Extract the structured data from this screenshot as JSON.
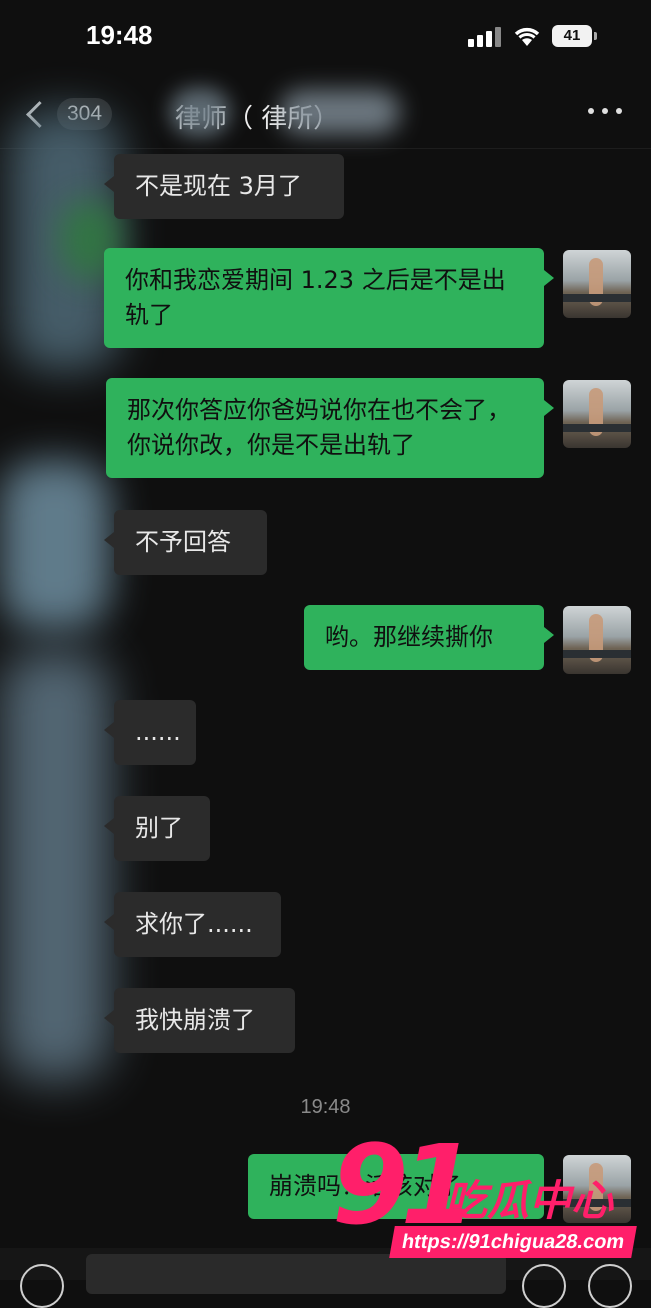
{
  "status_bar": {
    "time": "19:48",
    "battery": "41"
  },
  "nav": {
    "back_count": "304",
    "title": "律师（ 律所）"
  },
  "messages": [
    {
      "side": "in",
      "text": "不是现在 3月了"
    },
    {
      "side": "out",
      "text": "你和我恋爱期间 1.23 之后是不是出轨了"
    },
    {
      "side": "out",
      "text": "那次你答应你爸妈说你在也不会了，你说你改，你是不是出轨了"
    },
    {
      "side": "in",
      "text": "不予回答"
    },
    {
      "side": "out",
      "text": "哟。那继续撕你"
    },
    {
      "side": "in",
      "text": "......"
    },
    {
      "side": "in",
      "text": "别了"
    },
    {
      "side": "in",
      "text": "求你了......"
    },
    {
      "side": "in",
      "text": "我快崩溃了"
    },
    {
      "side": "out",
      "text": "崩溃吗？活该对了"
    }
  ],
  "timestamp": "19:48",
  "watermark": {
    "number": "91",
    "name": "吃瓜中心",
    "url": "https://91chigua28.com"
  },
  "colors": {
    "outgoing_bubble": "#2fb25c",
    "incoming_bubble": "#2b2b2b",
    "watermark": "#ff1f6a"
  }
}
